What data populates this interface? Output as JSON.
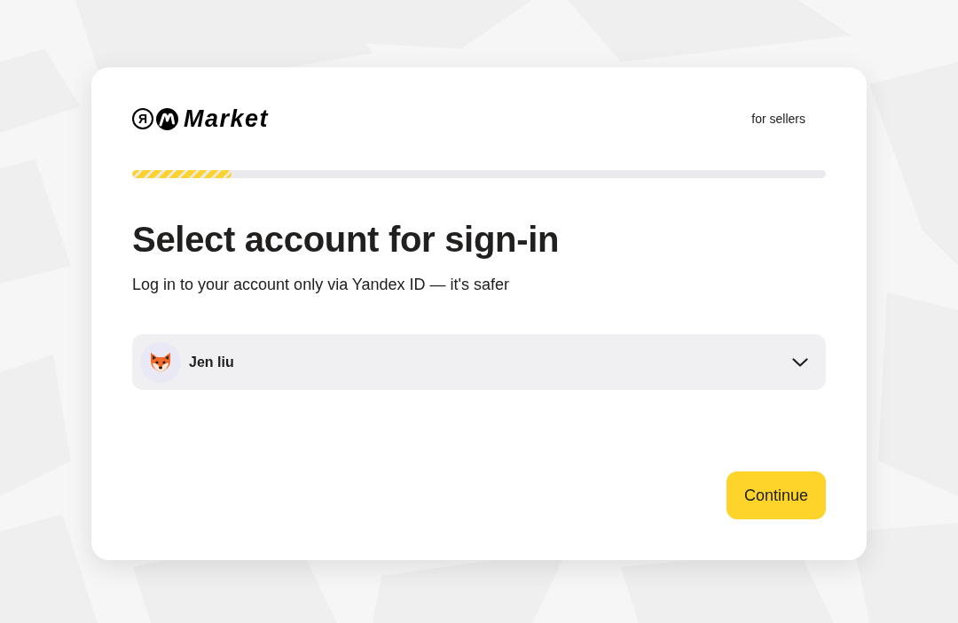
{
  "logo": {
    "mark": "Я",
    "text": "Market"
  },
  "header_link": "for sellers",
  "progress": {
    "level": 0.143
  },
  "title": "Select account for sign-in",
  "subtitle": "Log in to your account only via Yandex ID — it's safer",
  "account_select": {
    "name": "Jen liu"
  },
  "button": "Continue"
}
